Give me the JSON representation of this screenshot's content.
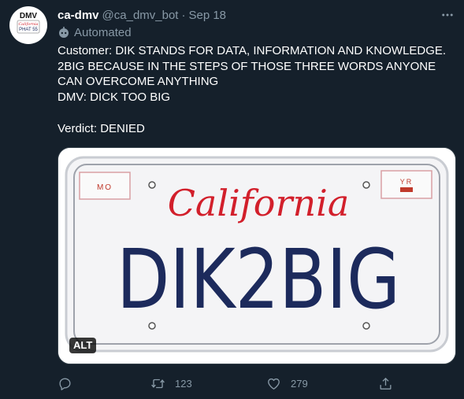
{
  "tweet": {
    "display_name": "ca-dmv",
    "handle": "@ca_dmv_bot",
    "separator": "·",
    "date": "Sep 18",
    "automated_label": "Automated",
    "text": "Customer: DIK STANDS FOR DATA, INFORMATION AND KNOWLEDGE. 2BIG BECAUSE IN THE STEPS OF THOSE THREE WORDS ANYONE CAN OVERCOME ANYTHING\nDMV: DICK TOO BIG\n\nVerdict: DENIED",
    "more_icon": "more-horizontal-icon"
  },
  "avatar": {
    "top_text": "DMV",
    "script_text": "California",
    "plate_text": "PHAT 55"
  },
  "media": {
    "plate": {
      "state": "California",
      "number": "DIK2BIG",
      "month_sticker": "MO",
      "year_sticker": "YR"
    },
    "alt_label": "ALT"
  },
  "actions": {
    "reply": {
      "icon": "reply-icon"
    },
    "retweet": {
      "icon": "retweet-icon",
      "count": "123"
    },
    "like": {
      "icon": "heart-icon",
      "count": "279"
    },
    "share": {
      "icon": "share-icon"
    }
  },
  "colors": {
    "background": "#15202b",
    "secondary_text": "#8899a6",
    "plate_red": "#d21f2b",
    "plate_blue": "#1c2a5c"
  }
}
